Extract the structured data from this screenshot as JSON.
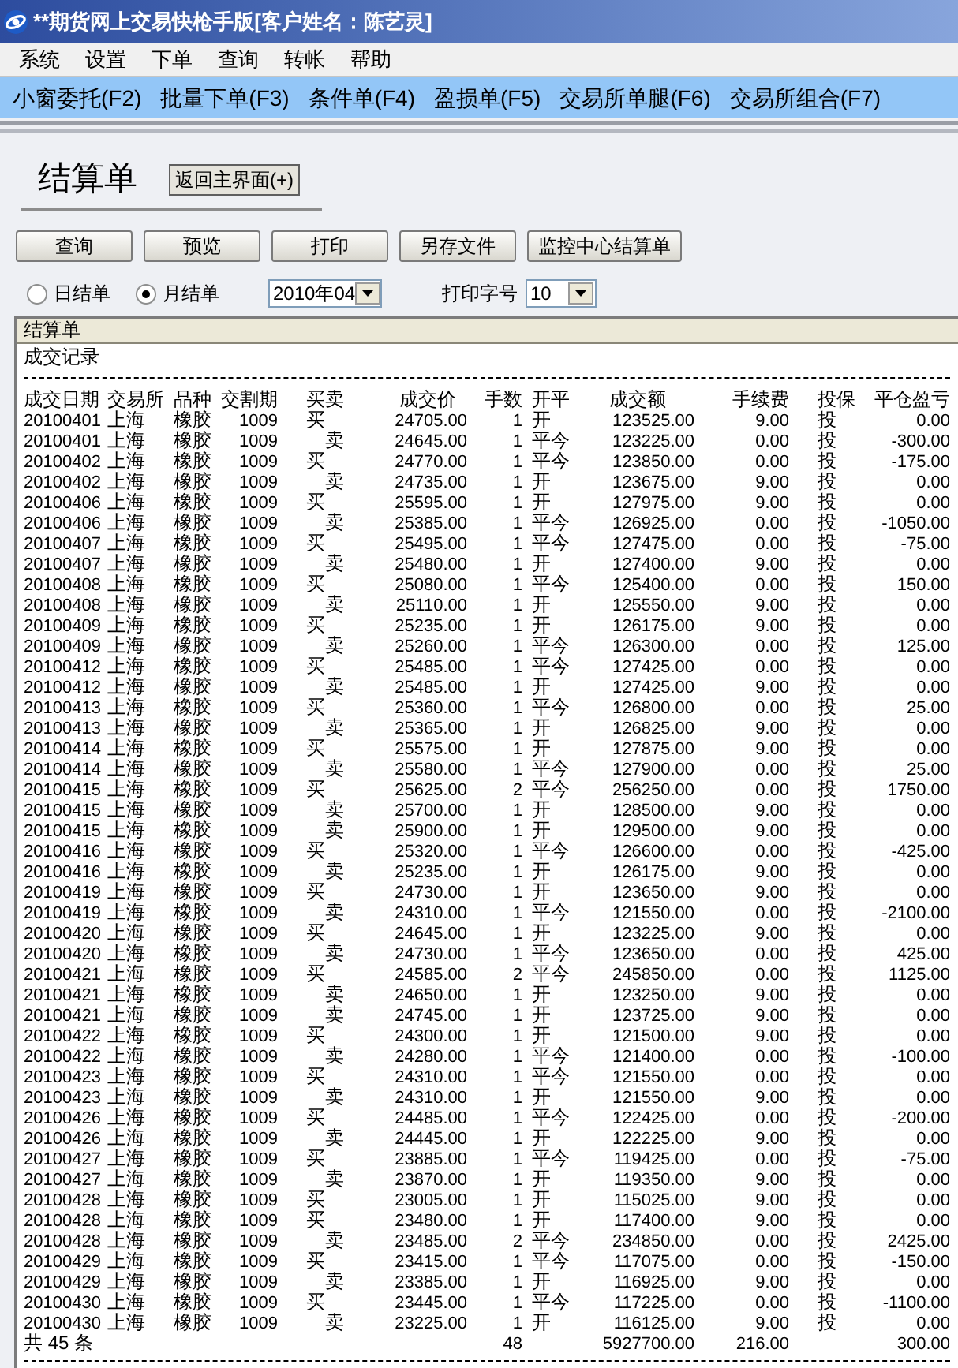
{
  "window": {
    "title": "**期货网上交易快枪手版[客户姓名：陈艺灵]"
  },
  "menu": [
    "系统",
    "设置",
    "下单",
    "查询",
    "转帐",
    "帮助"
  ],
  "toolbar": [
    "小窗委托(F2)",
    "批量下单(F3)",
    "条件单(F4)",
    "盈损单(F5)",
    "交易所单腿(F6)",
    "交易所组合(F7)"
  ],
  "page_title": "结算单",
  "back_button": "返回主界面(+)",
  "actions": [
    "查询",
    "预览",
    "打印",
    "另存文件",
    "监控中心结算单"
  ],
  "period_options": [
    {
      "label": "日结单",
      "selected": false
    },
    {
      "label": "月结单",
      "selected": true
    }
  ],
  "month_select": {
    "value": "2010年04"
  },
  "font_size": {
    "label": "打印字号",
    "value": "10"
  },
  "report": {
    "title": "结算单",
    "section": "成交记录",
    "columns": [
      "成交日期",
      "交易所",
      "品种",
      "交割期",
      "买卖",
      "成交价",
      "手数",
      "开平",
      "成交额",
      "手续费",
      "投保",
      "平仓盈亏"
    ],
    "rows": [
      {
        "kind": "buy",
        "cells": [
          "20100401",
          "上海",
          "橡胶",
          "1009",
          "买",
          "24705.00",
          "1",
          "开",
          "123525.00",
          "9.00",
          "投",
          "0.00"
        ]
      },
      {
        "kind": "sell",
        "cells": [
          "20100401",
          "上海",
          "橡胶",
          "1009",
          "卖",
          "24645.00",
          "1",
          "平今",
          "123225.00",
          "0.00",
          "投",
          "-300.00"
        ]
      },
      {
        "kind": "buy",
        "cells": [
          "20100402",
          "上海",
          "橡胶",
          "1009",
          "买",
          "24770.00",
          "1",
          "平今",
          "123850.00",
          "0.00",
          "投",
          "-175.00"
        ]
      },
      {
        "kind": "sell",
        "cells": [
          "20100402",
          "上海",
          "橡胶",
          "1009",
          "卖",
          "24735.00",
          "1",
          "开",
          "123675.00",
          "9.00",
          "投",
          "0.00"
        ]
      },
      {
        "kind": "buy",
        "cells": [
          "20100406",
          "上海",
          "橡胶",
          "1009",
          "买",
          "25595.00",
          "1",
          "开",
          "127975.00",
          "9.00",
          "投",
          "0.00"
        ]
      },
      {
        "kind": "sell",
        "cells": [
          "20100406",
          "上海",
          "橡胶",
          "1009",
          "卖",
          "25385.00",
          "1",
          "平今",
          "126925.00",
          "0.00",
          "投",
          "-1050.00"
        ]
      },
      {
        "kind": "buy",
        "cells": [
          "20100407",
          "上海",
          "橡胶",
          "1009",
          "买",
          "25495.00",
          "1",
          "平今",
          "127475.00",
          "0.00",
          "投",
          "-75.00"
        ]
      },
      {
        "kind": "sell",
        "cells": [
          "20100407",
          "上海",
          "橡胶",
          "1009",
          "卖",
          "25480.00",
          "1",
          "开",
          "127400.00",
          "9.00",
          "投",
          "0.00"
        ]
      },
      {
        "kind": "buy",
        "cells": [
          "20100408",
          "上海",
          "橡胶",
          "1009",
          "买",
          "25080.00",
          "1",
          "平今",
          "125400.00",
          "0.00",
          "投",
          "150.00"
        ]
      },
      {
        "kind": "sell",
        "cells": [
          "20100408",
          "上海",
          "橡胶",
          "1009",
          "卖",
          "25110.00",
          "1",
          "开",
          "125550.00",
          "9.00",
          "投",
          "0.00"
        ]
      },
      {
        "kind": "buy",
        "cells": [
          "20100409",
          "上海",
          "橡胶",
          "1009",
          "买",
          "25235.00",
          "1",
          "开",
          "126175.00",
          "9.00",
          "投",
          "0.00"
        ]
      },
      {
        "kind": "sell",
        "cells": [
          "20100409",
          "上海",
          "橡胶",
          "1009",
          "卖",
          "25260.00",
          "1",
          "平今",
          "126300.00",
          "0.00",
          "投",
          "125.00"
        ]
      },
      {
        "kind": "buy",
        "cells": [
          "20100412",
          "上海",
          "橡胶",
          "1009",
          "买",
          "25485.00",
          "1",
          "平今",
          "127425.00",
          "0.00",
          "投",
          "0.00"
        ]
      },
      {
        "kind": "sell",
        "cells": [
          "20100412",
          "上海",
          "橡胶",
          "1009",
          "卖",
          "25485.00",
          "1",
          "开",
          "127425.00",
          "9.00",
          "投",
          "0.00"
        ]
      },
      {
        "kind": "buy",
        "cells": [
          "20100413",
          "上海",
          "橡胶",
          "1009",
          "买",
          "25360.00",
          "1",
          "平今",
          "126800.00",
          "0.00",
          "投",
          "25.00"
        ]
      },
      {
        "kind": "sell",
        "cells": [
          "20100413",
          "上海",
          "橡胶",
          "1009",
          "卖",
          "25365.00",
          "1",
          "开",
          "126825.00",
          "9.00",
          "投",
          "0.00"
        ]
      },
      {
        "kind": "buy",
        "cells": [
          "20100414",
          "上海",
          "橡胶",
          "1009",
          "买",
          "25575.00",
          "1",
          "开",
          "127875.00",
          "9.00",
          "投",
          "0.00"
        ]
      },
      {
        "kind": "sell",
        "cells": [
          "20100414",
          "上海",
          "橡胶",
          "1009",
          "卖",
          "25580.00",
          "1",
          "平今",
          "127900.00",
          "0.00",
          "投",
          "25.00"
        ]
      },
      {
        "kind": "buy",
        "cells": [
          "20100415",
          "上海",
          "橡胶",
          "1009",
          "买",
          "25625.00",
          "2",
          "平今",
          "256250.00",
          "0.00",
          "投",
          "1750.00"
        ]
      },
      {
        "kind": "sell",
        "cells": [
          "20100415",
          "上海",
          "橡胶",
          "1009",
          "卖",
          "25700.00",
          "1",
          "开",
          "128500.00",
          "9.00",
          "投",
          "0.00"
        ]
      },
      {
        "kind": "sell",
        "cells": [
          "20100415",
          "上海",
          "橡胶",
          "1009",
          "卖",
          "25900.00",
          "1",
          "开",
          "129500.00",
          "9.00",
          "投",
          "0.00"
        ]
      },
      {
        "kind": "buy",
        "cells": [
          "20100416",
          "上海",
          "橡胶",
          "1009",
          "买",
          "25320.00",
          "1",
          "平今",
          "126600.00",
          "0.00",
          "投",
          "-425.00"
        ]
      },
      {
        "kind": "sell",
        "cells": [
          "20100416",
          "上海",
          "橡胶",
          "1009",
          "卖",
          "25235.00",
          "1",
          "开",
          "126175.00",
          "9.00",
          "投",
          "0.00"
        ]
      },
      {
        "kind": "buy",
        "cells": [
          "20100419",
          "上海",
          "橡胶",
          "1009",
          "买",
          "24730.00",
          "1",
          "开",
          "123650.00",
          "9.00",
          "投",
          "0.00"
        ]
      },
      {
        "kind": "sell",
        "cells": [
          "20100419",
          "上海",
          "橡胶",
          "1009",
          "卖",
          "24310.00",
          "1",
          "平今",
          "121550.00",
          "0.00",
          "投",
          "-2100.00"
        ]
      },
      {
        "kind": "buy",
        "cells": [
          "20100420",
          "上海",
          "橡胶",
          "1009",
          "买",
          "24645.00",
          "1",
          "开",
          "123225.00",
          "9.00",
          "投",
          "0.00"
        ]
      },
      {
        "kind": "sell",
        "cells": [
          "20100420",
          "上海",
          "橡胶",
          "1009",
          "卖",
          "24730.00",
          "1",
          "平今",
          "123650.00",
          "0.00",
          "投",
          "425.00"
        ]
      },
      {
        "kind": "buy",
        "cells": [
          "20100421",
          "上海",
          "橡胶",
          "1009",
          "买",
          "24585.00",
          "2",
          "平今",
          "245850.00",
          "0.00",
          "投",
          "1125.00"
        ]
      },
      {
        "kind": "sell",
        "cells": [
          "20100421",
          "上海",
          "橡胶",
          "1009",
          "卖",
          "24650.00",
          "1",
          "开",
          "123250.00",
          "9.00",
          "投",
          "0.00"
        ]
      },
      {
        "kind": "sell",
        "cells": [
          "20100421",
          "上海",
          "橡胶",
          "1009",
          "卖",
          "24745.00",
          "1",
          "开",
          "123725.00",
          "9.00",
          "投",
          "0.00"
        ]
      },
      {
        "kind": "buy",
        "cells": [
          "20100422",
          "上海",
          "橡胶",
          "1009",
          "买",
          "24300.00",
          "1",
          "开",
          "121500.00",
          "9.00",
          "投",
          "0.00"
        ]
      },
      {
        "kind": "sell",
        "cells": [
          "20100422",
          "上海",
          "橡胶",
          "1009",
          "卖",
          "24280.00",
          "1",
          "平今",
          "121400.00",
          "0.00",
          "投",
          "-100.00"
        ]
      },
      {
        "kind": "buy",
        "cells": [
          "20100423",
          "上海",
          "橡胶",
          "1009",
          "买",
          "24310.00",
          "1",
          "平今",
          "121550.00",
          "0.00",
          "投",
          "0.00"
        ]
      },
      {
        "kind": "sell",
        "cells": [
          "20100423",
          "上海",
          "橡胶",
          "1009",
          "卖",
          "24310.00",
          "1",
          "开",
          "121550.00",
          "9.00",
          "投",
          "0.00"
        ]
      },
      {
        "kind": "buy",
        "cells": [
          "20100426",
          "上海",
          "橡胶",
          "1009",
          "买",
          "24485.00",
          "1",
          "平今",
          "122425.00",
          "0.00",
          "投",
          "-200.00"
        ]
      },
      {
        "kind": "sell",
        "cells": [
          "20100426",
          "上海",
          "橡胶",
          "1009",
          "卖",
          "24445.00",
          "1",
          "开",
          "122225.00",
          "9.00",
          "投",
          "0.00"
        ]
      },
      {
        "kind": "buy",
        "cells": [
          "20100427",
          "上海",
          "橡胶",
          "1009",
          "买",
          "23885.00",
          "1",
          "平今",
          "119425.00",
          "0.00",
          "投",
          "-75.00"
        ]
      },
      {
        "kind": "sell",
        "cells": [
          "20100427",
          "上海",
          "橡胶",
          "1009",
          "卖",
          "23870.00",
          "1",
          "开",
          "119350.00",
          "9.00",
          "投",
          "0.00"
        ]
      },
      {
        "kind": "buy",
        "cells": [
          "20100428",
          "上海",
          "橡胶",
          "1009",
          "买",
          "23005.00",
          "1",
          "开",
          "115025.00",
          "9.00",
          "投",
          "0.00"
        ]
      },
      {
        "kind": "buy",
        "cells": [
          "20100428",
          "上海",
          "橡胶",
          "1009",
          "买",
          "23480.00",
          "1",
          "开",
          "117400.00",
          "9.00",
          "投",
          "0.00"
        ]
      },
      {
        "kind": "sell",
        "cells": [
          "20100428",
          "上海",
          "橡胶",
          "1009",
          "卖",
          "23485.00",
          "2",
          "平今",
          "234850.00",
          "0.00",
          "投",
          "2425.00"
        ]
      },
      {
        "kind": "buy",
        "cells": [
          "20100429",
          "上海",
          "橡胶",
          "1009",
          "买",
          "23415.00",
          "1",
          "平今",
          "117075.00",
          "0.00",
          "投",
          "-150.00"
        ]
      },
      {
        "kind": "sell",
        "cells": [
          "20100429",
          "上海",
          "橡胶",
          "1009",
          "卖",
          "23385.00",
          "1",
          "开",
          "116925.00",
          "9.00",
          "投",
          "0.00"
        ]
      },
      {
        "kind": "buy",
        "cells": [
          "20100430",
          "上海",
          "橡胶",
          "1009",
          "买",
          "23445.00",
          "1",
          "平今",
          "117225.00",
          "0.00",
          "投",
          "-1100.00"
        ]
      },
      {
        "kind": "sell",
        "cells": [
          "20100430",
          "上海",
          "橡胶",
          "1009",
          "卖",
          "23225.00",
          "1",
          "开",
          "116125.00",
          "9.00",
          "投",
          "0.00"
        ]
      }
    ],
    "total": {
      "label": "共 45 条",
      "quantity": "48",
      "amount": "5927700.00",
      "fee": "216.00",
      "profit": "300.00"
    }
  }
}
